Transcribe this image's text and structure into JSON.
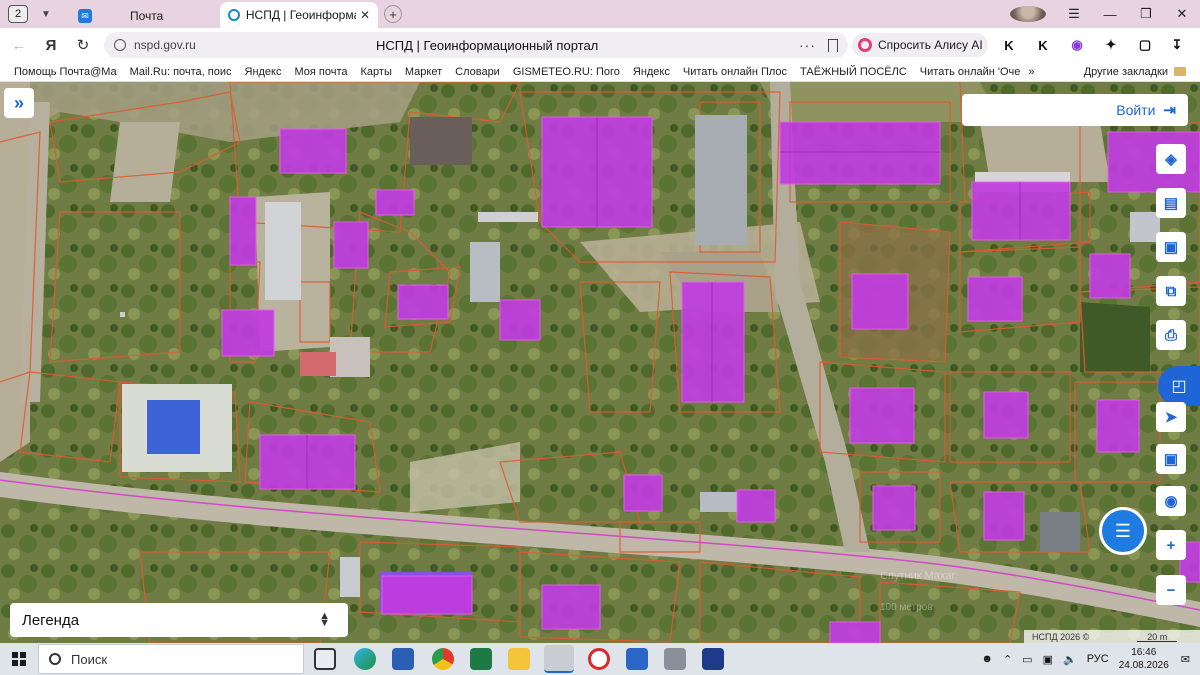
{
  "browser": {
    "tab_count": "2",
    "tabs": [
      {
        "label": "Почта",
        "icon": "mail-icon"
      },
      {
        "label": "НСПД | Геоинформационный портал",
        "icon": "globe-icon"
      }
    ],
    "url_host": "nspd.gov.ru",
    "page_title": "НСПД | Геоинформационный портал",
    "alice_label": "Спросить Алису AI",
    "bookmarks": [
      "Помощь Почта@Ма",
      "Mail.Ru: почта, поис",
      "Яндекс",
      "Моя почта",
      "Карты",
      "Маркет",
      "Словари",
      "GISMETEO.RU: Пого",
      "Яндекс",
      "Читать онлайн Плос",
      "ТАЁЖНЫЙ ПОСЁЛС",
      "Читать онлайн 'Оче"
    ],
    "bookmarks_more": "»",
    "other_bookmarks": "Другие закладки"
  },
  "map": {
    "login_label": "Войти",
    "legend_label": "Легенда",
    "attribution": "НСПД 2026 ©",
    "scale_label": "20 m",
    "watermark_line1": "Спутник Maxar",
    "watermark_line2": "100 метров"
  },
  "taskbar": {
    "search_placeholder": "Поиск",
    "lang": "РУС",
    "time": "16:46",
    "date": "24.08.2026"
  },
  "colors": {
    "accent": "#1e66d6",
    "building_fill": "#c03ce0",
    "parcel_line": "#e05a30"
  }
}
